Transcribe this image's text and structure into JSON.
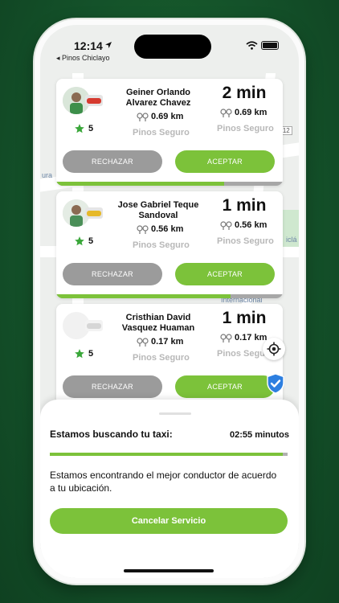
{
  "status_bar": {
    "time": "12:14",
    "back_app": "◂ Pinos Chiclayo"
  },
  "map": {
    "labels": [
      "ura",
      "112",
      "iclá",
      "Internacional",
      "nal"
    ]
  },
  "drivers": [
    {
      "name": "Geiner Orlando Alvarez Chavez",
      "rating": "5",
      "distance": "0.69 km",
      "company": "Pinos Seguro",
      "eta": "2 min",
      "eta_distance": "0.69 km",
      "eta_company": "Pinos Seguro",
      "reject_label": "RECHAZAR",
      "accept_label": "ACEPTAR",
      "car_color": "#d63a2f",
      "progress": 0.74
    },
    {
      "name": "Jose Gabriel Teque Sandoval",
      "rating": "5",
      "distance": "0.56 km",
      "company": "Pinos Seguro",
      "eta": "1 min",
      "eta_distance": "0.56 km",
      "eta_company": "Pinos Seguro",
      "reject_label": "RECHAZAR",
      "accept_label": "ACEPTAR",
      "car_color": "#e6b92a",
      "progress": 0.77
    },
    {
      "name": "Cristhian David Vasquez Huaman",
      "rating": "5",
      "distance": "0.17 km",
      "company": "Pinos Seguro",
      "eta": "1 min",
      "eta_distance": "0.17 km",
      "eta_company": "Pinos Seguro",
      "reject_label": "RECHAZAR",
      "accept_label": "ACEPTAR",
      "car_color": "#d6d6d6",
      "progress": 0.5
    }
  ],
  "sheet": {
    "title": "Estamos buscando tu taxi:",
    "countdown": "02:55 minutos",
    "progress": 0.98,
    "description": "Estamos encontrando el mejor conductor de acuerdo a tu ubicación.",
    "cancel_label": "Cancelar Servicio"
  },
  "colors": {
    "accent": "#7cc23a",
    "background": "#14522a",
    "reject": "#9b9b9b",
    "star": "#3aa73a",
    "shield": "#2d7fe0"
  },
  "icons": [
    "location-arrow-icon",
    "wifi-icon",
    "battery-icon",
    "star-icon",
    "pin-icon",
    "gps-target-icon",
    "shield-check-icon"
  ]
}
